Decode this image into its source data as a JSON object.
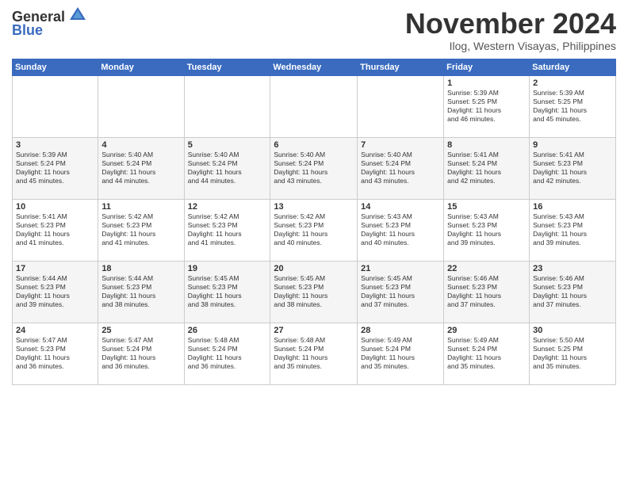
{
  "header": {
    "logo_line1": "General",
    "logo_line2": "Blue",
    "month": "November 2024",
    "location": "Ilog, Western Visayas, Philippines"
  },
  "weekdays": [
    "Sunday",
    "Monday",
    "Tuesday",
    "Wednesday",
    "Thursday",
    "Friday",
    "Saturday"
  ],
  "weeks": [
    [
      {
        "day": "",
        "info": ""
      },
      {
        "day": "",
        "info": ""
      },
      {
        "day": "",
        "info": ""
      },
      {
        "day": "",
        "info": ""
      },
      {
        "day": "",
        "info": ""
      },
      {
        "day": "1",
        "info": "Sunrise: 5:39 AM\nSunset: 5:25 PM\nDaylight: 11 hours\nand 46 minutes."
      },
      {
        "day": "2",
        "info": "Sunrise: 5:39 AM\nSunset: 5:25 PM\nDaylight: 11 hours\nand 45 minutes."
      }
    ],
    [
      {
        "day": "3",
        "info": "Sunrise: 5:39 AM\nSunset: 5:24 PM\nDaylight: 11 hours\nand 45 minutes."
      },
      {
        "day": "4",
        "info": "Sunrise: 5:40 AM\nSunset: 5:24 PM\nDaylight: 11 hours\nand 44 minutes."
      },
      {
        "day": "5",
        "info": "Sunrise: 5:40 AM\nSunset: 5:24 PM\nDaylight: 11 hours\nand 44 minutes."
      },
      {
        "day": "6",
        "info": "Sunrise: 5:40 AM\nSunset: 5:24 PM\nDaylight: 11 hours\nand 43 minutes."
      },
      {
        "day": "7",
        "info": "Sunrise: 5:40 AM\nSunset: 5:24 PM\nDaylight: 11 hours\nand 43 minutes."
      },
      {
        "day": "8",
        "info": "Sunrise: 5:41 AM\nSunset: 5:24 PM\nDaylight: 11 hours\nand 42 minutes."
      },
      {
        "day": "9",
        "info": "Sunrise: 5:41 AM\nSunset: 5:23 PM\nDaylight: 11 hours\nand 42 minutes."
      }
    ],
    [
      {
        "day": "10",
        "info": "Sunrise: 5:41 AM\nSunset: 5:23 PM\nDaylight: 11 hours\nand 41 minutes."
      },
      {
        "day": "11",
        "info": "Sunrise: 5:42 AM\nSunset: 5:23 PM\nDaylight: 11 hours\nand 41 minutes."
      },
      {
        "day": "12",
        "info": "Sunrise: 5:42 AM\nSunset: 5:23 PM\nDaylight: 11 hours\nand 41 minutes."
      },
      {
        "day": "13",
        "info": "Sunrise: 5:42 AM\nSunset: 5:23 PM\nDaylight: 11 hours\nand 40 minutes."
      },
      {
        "day": "14",
        "info": "Sunrise: 5:43 AM\nSunset: 5:23 PM\nDaylight: 11 hours\nand 40 minutes."
      },
      {
        "day": "15",
        "info": "Sunrise: 5:43 AM\nSunset: 5:23 PM\nDaylight: 11 hours\nand 39 minutes."
      },
      {
        "day": "16",
        "info": "Sunrise: 5:43 AM\nSunset: 5:23 PM\nDaylight: 11 hours\nand 39 minutes."
      }
    ],
    [
      {
        "day": "17",
        "info": "Sunrise: 5:44 AM\nSunset: 5:23 PM\nDaylight: 11 hours\nand 39 minutes."
      },
      {
        "day": "18",
        "info": "Sunrise: 5:44 AM\nSunset: 5:23 PM\nDaylight: 11 hours\nand 38 minutes."
      },
      {
        "day": "19",
        "info": "Sunrise: 5:45 AM\nSunset: 5:23 PM\nDaylight: 11 hours\nand 38 minutes."
      },
      {
        "day": "20",
        "info": "Sunrise: 5:45 AM\nSunset: 5:23 PM\nDaylight: 11 hours\nand 38 minutes."
      },
      {
        "day": "21",
        "info": "Sunrise: 5:45 AM\nSunset: 5:23 PM\nDaylight: 11 hours\nand 37 minutes."
      },
      {
        "day": "22",
        "info": "Sunrise: 5:46 AM\nSunset: 5:23 PM\nDaylight: 11 hours\nand 37 minutes."
      },
      {
        "day": "23",
        "info": "Sunrise: 5:46 AM\nSunset: 5:23 PM\nDaylight: 11 hours\nand 37 minutes."
      }
    ],
    [
      {
        "day": "24",
        "info": "Sunrise: 5:47 AM\nSunset: 5:23 PM\nDaylight: 11 hours\nand 36 minutes."
      },
      {
        "day": "25",
        "info": "Sunrise: 5:47 AM\nSunset: 5:24 PM\nDaylight: 11 hours\nand 36 minutes."
      },
      {
        "day": "26",
        "info": "Sunrise: 5:48 AM\nSunset: 5:24 PM\nDaylight: 11 hours\nand 36 minutes."
      },
      {
        "day": "27",
        "info": "Sunrise: 5:48 AM\nSunset: 5:24 PM\nDaylight: 11 hours\nand 35 minutes."
      },
      {
        "day": "28",
        "info": "Sunrise: 5:49 AM\nSunset: 5:24 PM\nDaylight: 11 hours\nand 35 minutes."
      },
      {
        "day": "29",
        "info": "Sunrise: 5:49 AM\nSunset: 5:24 PM\nDaylight: 11 hours\nand 35 minutes."
      },
      {
        "day": "30",
        "info": "Sunrise: 5:50 AM\nSunset: 5:25 PM\nDaylight: 11 hours\nand 35 minutes."
      }
    ]
  ]
}
